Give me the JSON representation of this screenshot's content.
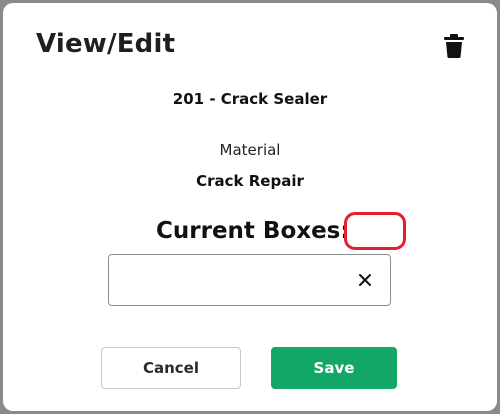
{
  "modal": {
    "title": "View/Edit",
    "delete_icon": "trash-icon"
  },
  "item": {
    "name": "201 - Crack Sealer"
  },
  "material": {
    "label": "Material",
    "value": "Crack Repair"
  },
  "boxes": {
    "label": "Current Boxes:",
    "value": "",
    "input_value": "",
    "clear_icon": "close-icon"
  },
  "buttons": {
    "cancel_label": "Cancel",
    "save_label": "Save"
  },
  "colors": {
    "save_green": "#12a766",
    "marker_red": "#e3202c",
    "backdrop": "#8a8a8a"
  }
}
